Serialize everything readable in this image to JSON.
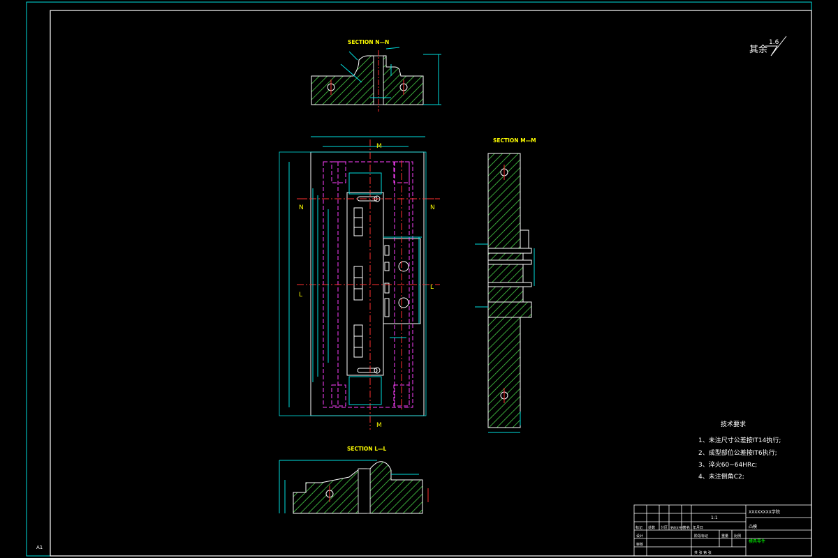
{
  "sheet": {
    "size_label": "A1",
    "colors": {
      "background": "#000000",
      "border": "#00e0e0",
      "outline": "#ffffff",
      "hatch": "#3aa83a",
      "center": "#ff3030",
      "hidden": "#ff40ff",
      "text": "#ffff00",
      "dimension": "#00e0e0"
    }
  },
  "roughness": {
    "prefix": "其余",
    "value": "1.6"
  },
  "sections": {
    "nn": "SECTION N—N",
    "mm": "SECTION M—M",
    "ll": "SECTION L—L"
  },
  "cut_markers": {
    "m": "M",
    "n": "N",
    "l": "L"
  },
  "tech": {
    "heading": "技术要求",
    "items": [
      "1、未注尺寸公差按IT14执行;",
      "2、成型部位公差按IT6执行;",
      "3、淬火60~64HRc;",
      "4、未注倒角C2;"
    ]
  },
  "title_block": {
    "company": "XXXXXXXX学院",
    "scale": "1:1",
    "part_name": "凸模",
    "drawing_no": "模具零件",
    "row_labels": [
      "标记",
      "处数",
      "分区",
      "更改文件号",
      "签名",
      "年月日"
    ],
    "label_design": "设计",
    "label_check": "审核",
    "label_stage": "阶段标记",
    "label_weight": "重量",
    "label_ratio": "比例",
    "label_sheets": "共 张 第 张"
  }
}
